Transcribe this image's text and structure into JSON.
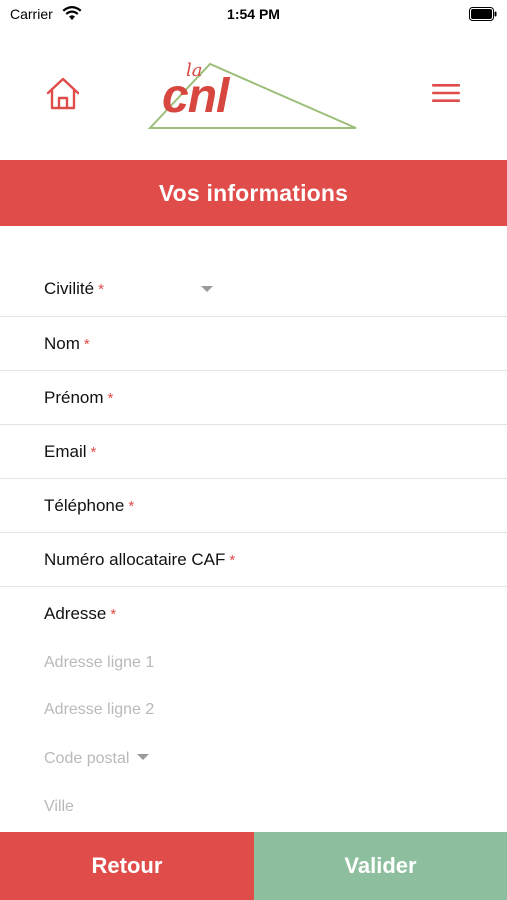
{
  "status_bar": {
    "carrier": "Carrier",
    "time": "1:54 PM",
    "wifi_icon": "wifi-icon",
    "battery_icon": "battery-icon"
  },
  "header": {
    "home_icon": "home-icon",
    "menu_icon": "hamburger-menu-icon",
    "logo_small_text": "la",
    "logo_text": "cnl",
    "logo_text_color": "#d8473f",
    "logo_triangle_color": "#9cbf7a"
  },
  "banner": {
    "title": "Vos informations",
    "color": "#e04c4a"
  },
  "form": {
    "required_marker": "*",
    "fields": [
      {
        "label": "Civilité",
        "type": "select"
      },
      {
        "label": "Nom",
        "type": "text"
      },
      {
        "label": "Prénom",
        "type": "text"
      },
      {
        "label": "Email",
        "type": "text"
      },
      {
        "label": "Téléphone",
        "type": "text"
      },
      {
        "label": "Numéro allocataire CAF",
        "type": "text"
      }
    ],
    "address": {
      "label": "Adresse",
      "line1_placeholder": "Adresse ligne 1",
      "line2_placeholder": "Adresse ligne 2",
      "postal_placeholder": "Code postal",
      "city_placeholder": "Ville"
    }
  },
  "actions": {
    "back_label": "Retour",
    "back_color": "#e04c4a",
    "validate_label": "Valider",
    "validate_color": "#8dbf9e"
  }
}
